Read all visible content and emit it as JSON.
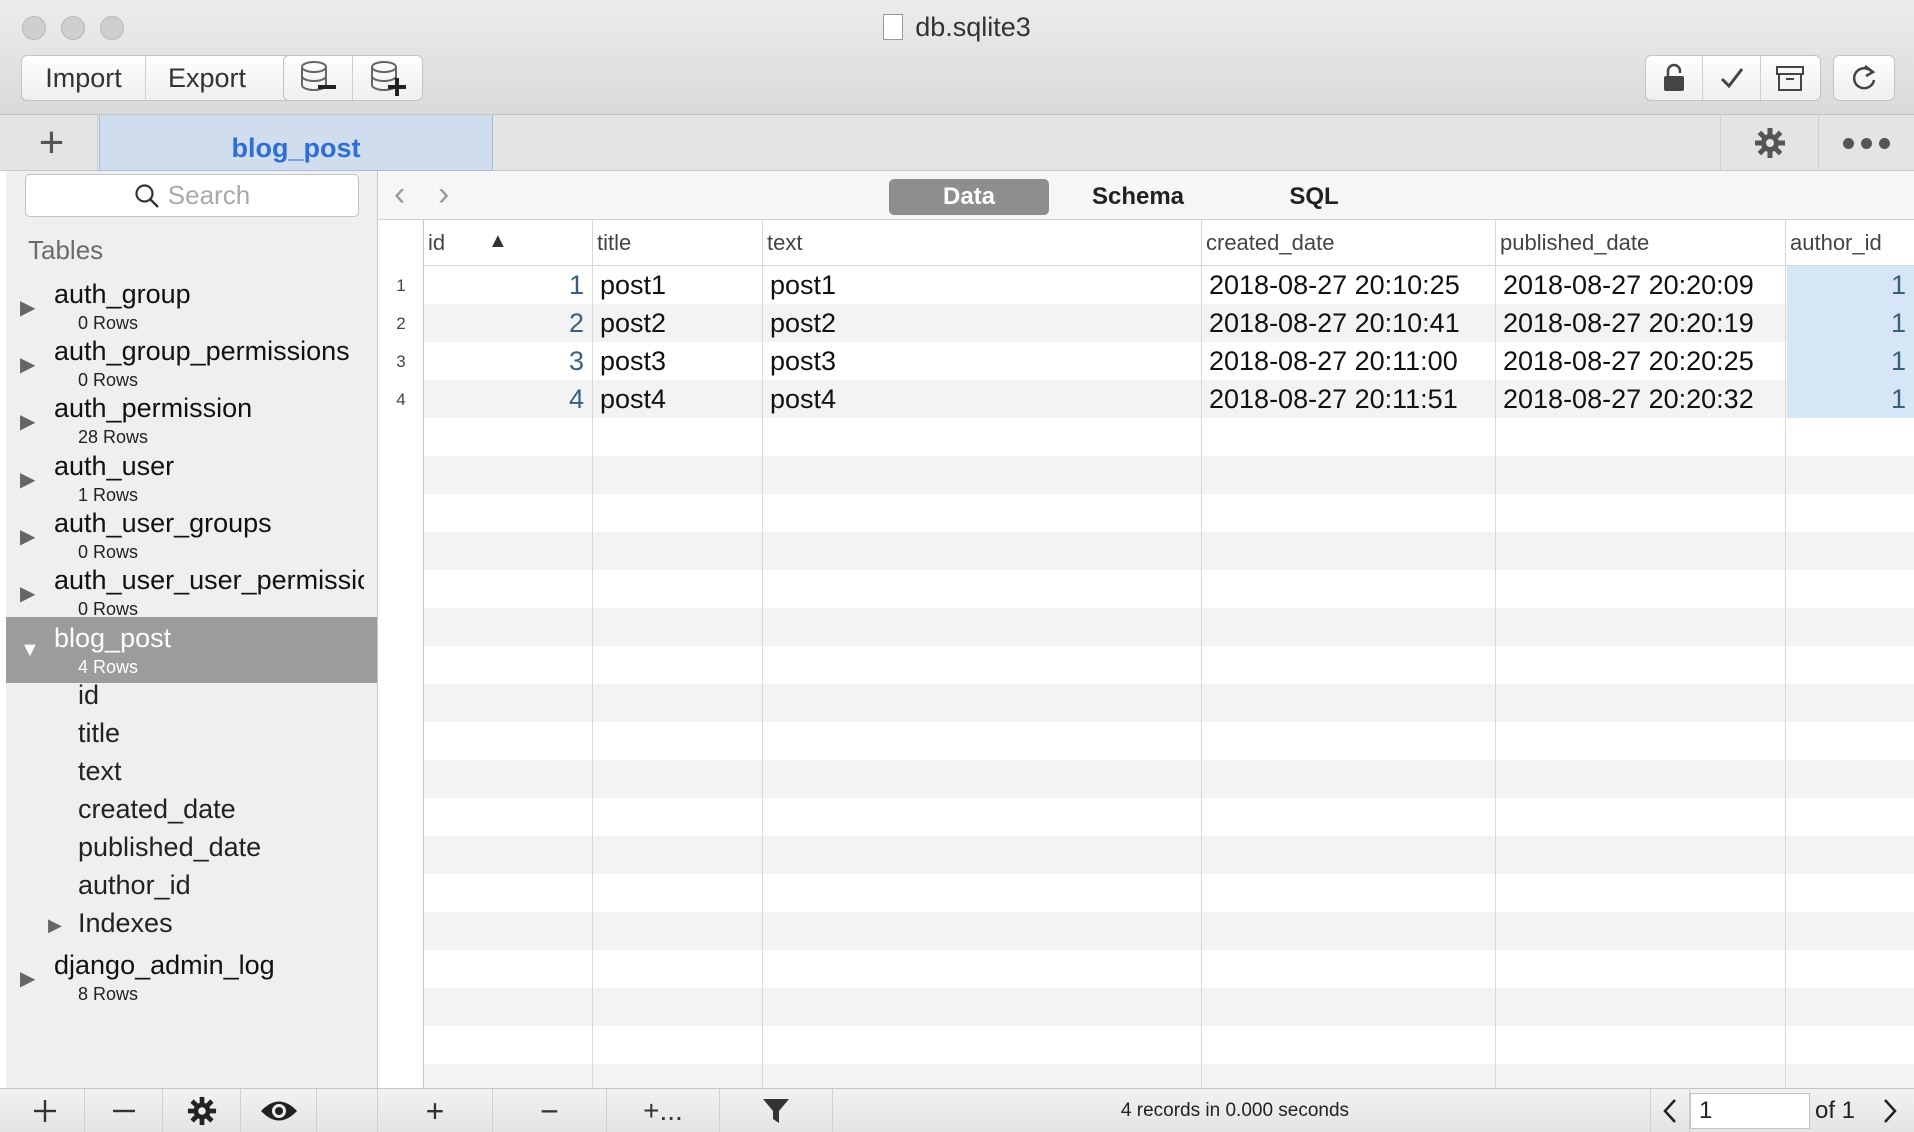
{
  "window": {
    "title": "db.sqlite3"
  },
  "toolbar": {
    "import_label": "Import",
    "export_label": "Export",
    "icons": [
      "db-remove-icon",
      "db-add-icon",
      "lock-icon",
      "check-icon",
      "archive-icon",
      "refresh-icon"
    ]
  },
  "tabs": {
    "active_label": "blog_post",
    "add_label": "+"
  },
  "sidebar": {
    "search_placeholder": "Search",
    "header": "Tables",
    "tables": [
      {
        "name": "auth_group",
        "rows": "0 Rows"
      },
      {
        "name": "auth_group_permissions",
        "rows": "0 Rows"
      },
      {
        "name": "auth_permission",
        "rows": "28 Rows"
      },
      {
        "name": "auth_user",
        "rows": "1 Rows"
      },
      {
        "name": "auth_user_groups",
        "rows": "0 Rows"
      },
      {
        "name": "auth_user_user_permissic",
        "rows": "0 Rows"
      },
      {
        "name": "blog_post",
        "rows": "4 Rows"
      },
      {
        "name": "django_admin_log",
        "rows": "8 Rows"
      }
    ],
    "blog_post_columns": [
      "id",
      "title",
      "text",
      "created_date",
      "published_date",
      "author_id"
    ],
    "indexes_label": "Indexes"
  },
  "view_tabs": {
    "data": "Data",
    "schema": "Schema",
    "sql": "SQL"
  },
  "grid": {
    "columns": [
      "id",
      "title",
      "text",
      "created_date",
      "published_date",
      "author_id"
    ],
    "sort_indicator": "▲",
    "row_numbers": [
      "1",
      "2",
      "3",
      "4"
    ],
    "rows": [
      {
        "id": "1",
        "title": "post1",
        "text": "post1",
        "created_date": "2018-08-27 20:10:25",
        "published_date": "2018-08-27 20:20:09",
        "author_id": "1"
      },
      {
        "id": "2",
        "title": "post2",
        "text": "post2",
        "created_date": "2018-08-27 20:10:41",
        "published_date": "2018-08-27 20:20:19",
        "author_id": "1"
      },
      {
        "id": "3",
        "title": "post3",
        "text": "post3",
        "created_date": "2018-08-27 20:11:00",
        "published_date": "2018-08-27 20:20:25",
        "author_id": "1"
      },
      {
        "id": "4",
        "title": "post4",
        "text": "post4",
        "created_date": "2018-08-27 20:11:51",
        "published_date": "2018-08-27 20:20:32",
        "author_id": "1"
      }
    ]
  },
  "bottom_bar": {
    "add_row": "+",
    "remove_row": "−",
    "add_column": "+...",
    "status": "4 records in 0.000 seconds",
    "page_value": "1",
    "page_total": "of 1"
  }
}
